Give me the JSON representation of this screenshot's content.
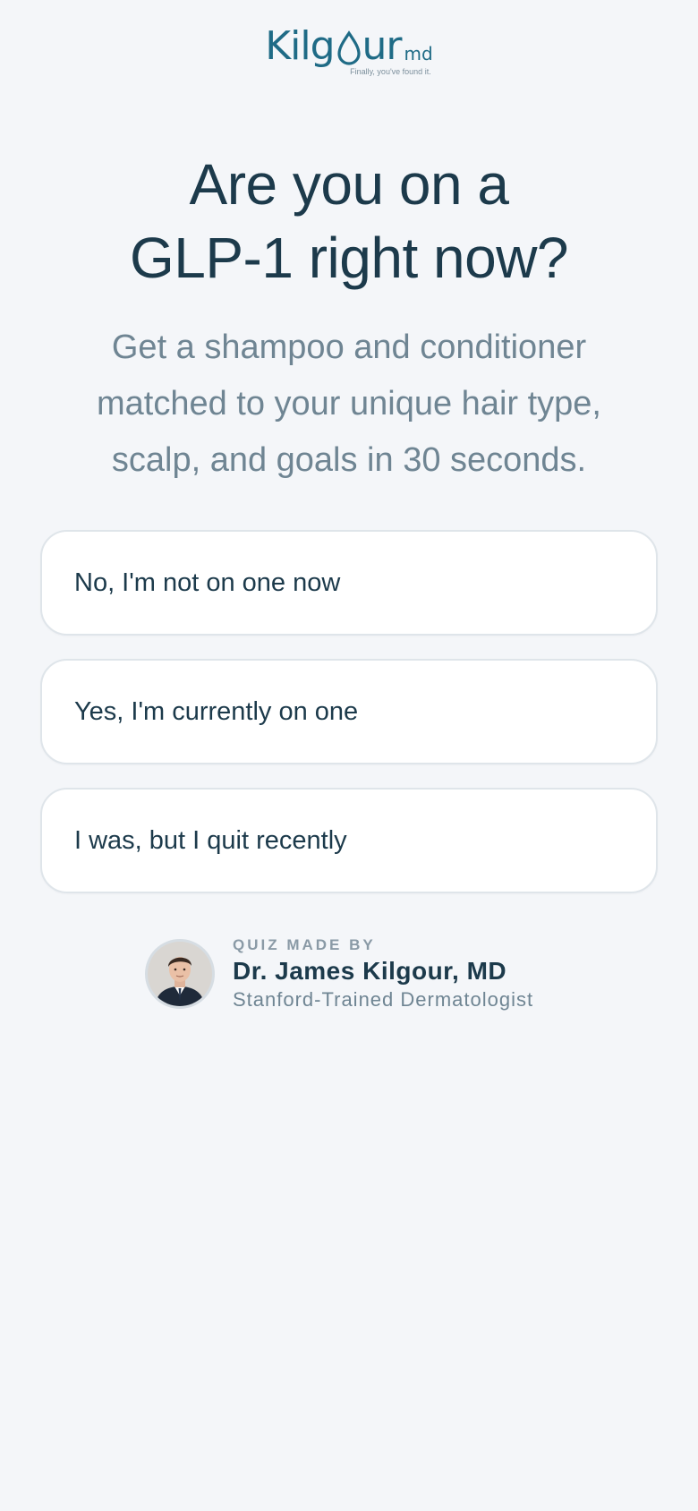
{
  "brand": {
    "name_part1": "Kilg",
    "name_part2": "ur",
    "suffix": "md",
    "tagline": "Finally, you've found it."
  },
  "headline": {
    "line1": "Are you on a",
    "line2": "GLP-1 right now?"
  },
  "subhead": "Get a shampoo and conditioner matched to your unique hair type, scalp, and goals in 30 seconds.",
  "options": [
    {
      "label": "No, I'm not on one now"
    },
    {
      "label": "Yes, I'm currently on one"
    },
    {
      "label": "I was, but I quit recently"
    }
  ],
  "author": {
    "eyebrow": "QUIZ MADE BY",
    "name": "Dr. James Kilgour, MD",
    "title": "Stanford-Trained Dermatologist"
  },
  "colors": {
    "background": "#f4f6f9",
    "brand_teal": "#1f6b86",
    "heading": "#1c3a4b",
    "muted": "#6f8593",
    "card_border": "#dfe5ea"
  },
  "icons": {
    "logo": "kilgour-md-logo",
    "avatar": "doctor-portrait"
  }
}
